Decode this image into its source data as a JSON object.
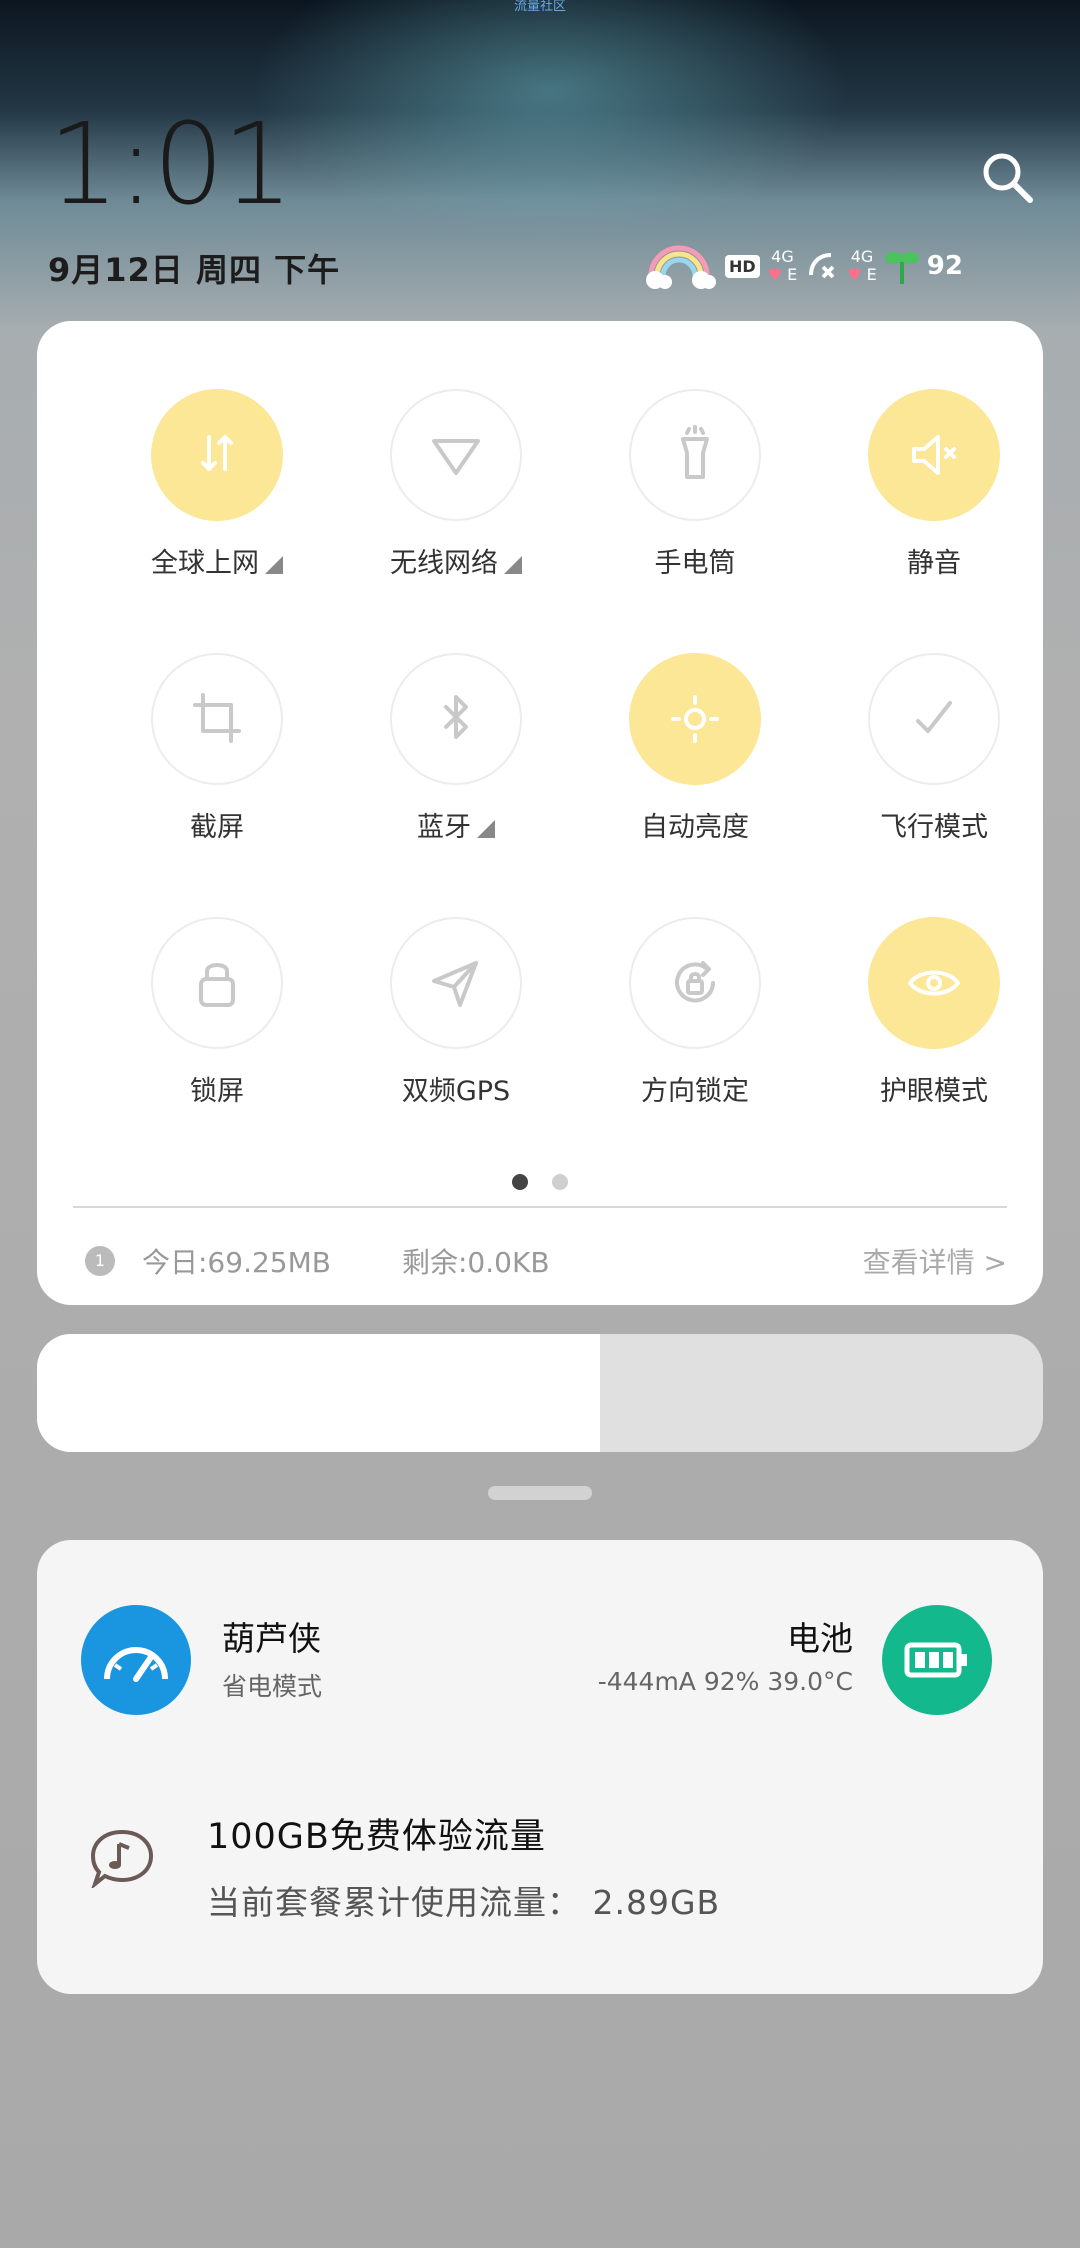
{
  "top_note": "流量社区",
  "clock": {
    "time": "1:01",
    "date": "9月12日 周四 下午"
  },
  "status_bar": {
    "hd_label": "HD",
    "sim1": "4G",
    "sim1_type": "E",
    "sim2": "4G",
    "sim2_type": "E",
    "battery_level": "92"
  },
  "toggles": [
    {
      "label": "全球上网",
      "icon": "data-arrows-icon",
      "on": true,
      "expandable": true
    },
    {
      "label": "无线网络",
      "icon": "wifi-icon",
      "on": false,
      "expandable": true
    },
    {
      "label": "手电筒",
      "icon": "flashlight-icon",
      "on": false,
      "expandable": false
    },
    {
      "label": "静音",
      "icon": "mute-icon",
      "on": true,
      "expandable": false
    },
    {
      "label": "截屏",
      "icon": "crop-icon",
      "on": false,
      "expandable": false
    },
    {
      "label": "蓝牙",
      "icon": "bluetooth-icon",
      "on": false,
      "expandable": true
    },
    {
      "label": "自动亮度",
      "icon": "brightness-icon",
      "on": true,
      "expandable": false
    },
    {
      "label": "飞行模式",
      "icon": "airplane-icon",
      "on": false,
      "expandable": false
    },
    {
      "label": "锁屏",
      "icon": "lock-icon",
      "on": false,
      "expandable": false
    },
    {
      "label": "双频GPS",
      "icon": "gps-icon",
      "on": false,
      "expandable": false
    },
    {
      "label": "方向锁定",
      "icon": "rotation-lock-icon",
      "on": false,
      "expandable": false
    },
    {
      "label": "护眼模式",
      "icon": "eye-icon",
      "on": true,
      "expandable": false
    }
  ],
  "pager": {
    "pages": 2,
    "current": 1
  },
  "data_usage": {
    "sim_badge": "1",
    "today": "今日:69.25MB",
    "remaining": "剩余:0.0KB",
    "details": "查看详情 >"
  },
  "brightness_level": 0.56,
  "notification": {
    "app1_title": "葫芦侠",
    "app1_subtitle": "省电模式",
    "app2_title": "电池",
    "app2_subtitle": "-444mA 92% 39.0°C",
    "promo_title": "100GB免费体验流量",
    "promo_detail": "当前套餐累计使用流量： 2.89GB"
  },
  "colors": {
    "toggle_on": "#fce797",
    "toggle_off_icon": "#c9c9c9",
    "toggle_on_icon": "#ffffff",
    "app1_bg": "#1a95e0",
    "app2_bg": "#13b88d",
    "pager_active": "#444444",
    "pager_inactive": "#cfcfcf"
  }
}
